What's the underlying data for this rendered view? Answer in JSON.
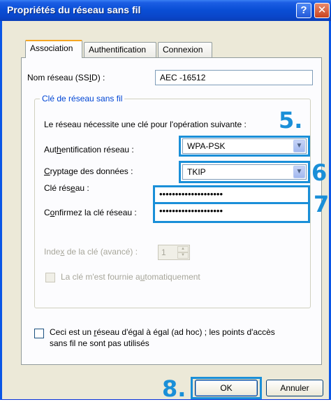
{
  "window": {
    "title": "Propriétés du réseau sans fil",
    "help_label": "?",
    "close_label": "✕"
  },
  "tabs": [
    {
      "label": "Association"
    },
    {
      "label": "Authentification"
    },
    {
      "label": "Connexion"
    }
  ],
  "ssid": {
    "label_pre": "Nom réseau (SS",
    "label_u": "I",
    "label_post": "D) :",
    "value": "AEC -16512"
  },
  "key_group": {
    "title": "Clé de réseau sans fil",
    "intro": "Le réseau nécessite une clé pour l'opération suivante :",
    "auth": {
      "label_pre": "Aut",
      "label_u": "h",
      "label_post": "entification réseau :",
      "value": "WPA-PSK"
    },
    "crypt": {
      "label_pre": "",
      "label_u": "C",
      "label_post": "ryptage des données :",
      "value": "TKIP"
    },
    "key": {
      "label_pre": "Clé rés",
      "label_u": "e",
      "label_post": "au :",
      "value": "••••••••••••••••••••"
    },
    "confirm": {
      "label_pre": "C",
      "label_u": "o",
      "label_post": "nfirmez la clé réseau :",
      "value": "••••••••••••••••••••"
    },
    "index": {
      "label_pre": "Inde",
      "label_u": "x",
      "label_post": " de la clé (avancé) :",
      "value": "1"
    },
    "auto": {
      "label_pre": "La clé m'est fournie a",
      "label_u": "u",
      "label_post": "tomatiquement"
    }
  },
  "adhoc": {
    "line1_pre": "Ceci est un ",
    "line1_u": "r",
    "line1_post": "éseau d'égal à égal (ad hoc) ; les points d'accès",
    "line2": "sans fil ne sont pas utilisés"
  },
  "buttons": {
    "ok": "OK",
    "cancel": "Annuler"
  },
  "steps": {
    "s5": "5.",
    "s6": "6",
    "s7": "7.",
    "s8": "8."
  },
  "colors": {
    "highlight": "#1a8fd8",
    "titlebar": "#0a4fd6"
  }
}
